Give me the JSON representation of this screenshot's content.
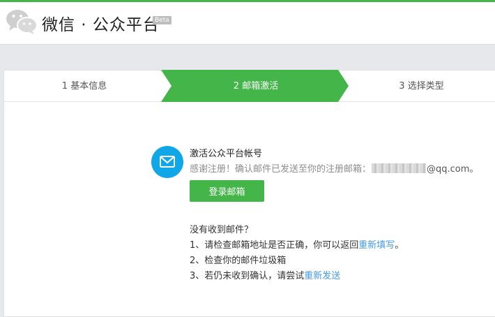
{
  "header": {
    "title": "微信 · 公众平台",
    "badge": "Beta",
    "logo_icon": "wechat-logo-icon"
  },
  "colors": {
    "accent_green": "#44b549",
    "mail_blue": "#0fa7e7",
    "link_blue": "#459ae9",
    "page_bg": "#e7e8eb"
  },
  "steps": [
    {
      "label": "1 基本信息",
      "active": false
    },
    {
      "label": "2 邮箱激活",
      "active": true
    },
    {
      "label": "3 选择类型",
      "active": false
    }
  ],
  "activation": {
    "icon": "mail-icon",
    "title": "激活公众平台帐号",
    "sent_prefix": "感谢注册！确认邮件已发送至你的注册邮箱：",
    "email_domain": "@qq.com。",
    "login_button": "登录邮箱"
  },
  "help": {
    "heading": "没有收到邮件？",
    "item1_prefix": "1、请检查邮箱地址是否正确，你可以返回",
    "item1_link": "重新填写",
    "item1_suffix": "。",
    "item2": "2、检查你的邮件垃圾箱",
    "item3_prefix": "3、若仍未收到确认，请尝试",
    "item3_link": "重新发送"
  }
}
